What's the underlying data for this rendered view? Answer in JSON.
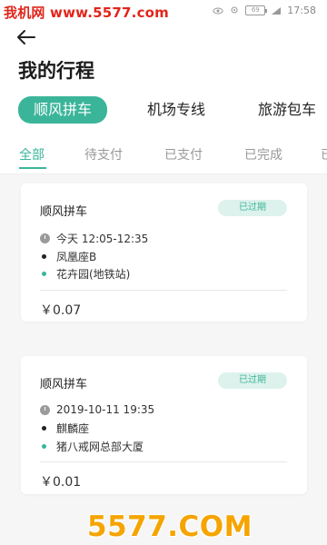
{
  "watermark_top": "我机网 www.5577.com",
  "watermark_bottom": "5577.COM",
  "status_bar": {
    "time": "17:58",
    "battery": "69"
  },
  "title": "我的行程",
  "category_tabs": [
    "顺风拼车",
    "机场专线",
    "旅游包车"
  ],
  "status_tabs": [
    "全部",
    "待支付",
    "已支付",
    "已完成",
    "已"
  ],
  "trips": [
    {
      "type": "顺风拼车",
      "status": "已过期",
      "time": "今天 12:05-12:35",
      "from": "凤凰座B",
      "to": "花卉园(地铁站)",
      "price": "￥0.07"
    },
    {
      "type": "顺风拼车",
      "status": "已过期",
      "time": "2019-10-11 19:35",
      "from": "麒麟座",
      "to": "猪八戒网总部大厦",
      "price": "￥0.01"
    }
  ],
  "colors": {
    "accent": "#3bb59a",
    "badge_bg": "#ddf2ec",
    "watermark_red": "#e1251b",
    "watermark_orange": "#f5a400"
  }
}
